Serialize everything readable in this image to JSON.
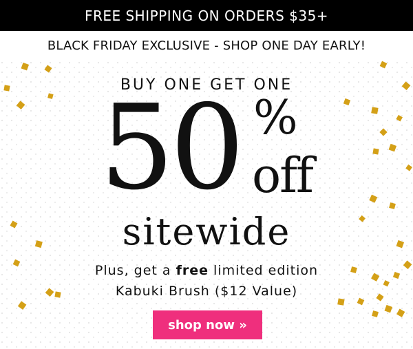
{
  "banner": {
    "text": "FREE SHIPPING ON ORDERS $35+"
  },
  "promo": {
    "exclusive": "BLACK FRIDAY EXCLUSIVE -  SHOP ONE DAY EARLY!",
    "bogo": "BUY ONE GET ONE",
    "amount": "50",
    "percent": "%",
    "off": "off",
    "scope": "sitewide",
    "plus_prefix": "Plus, get a ",
    "plus_free": "free",
    "plus_suffix": " limited edition",
    "gift": "Kabuki Brush ($12 Value)"
  },
  "cta": {
    "label": "shop now »",
    "color": "#ef2f7d"
  },
  "colors": {
    "gold": "#d4a017",
    "dots": "#cfcfcf"
  }
}
